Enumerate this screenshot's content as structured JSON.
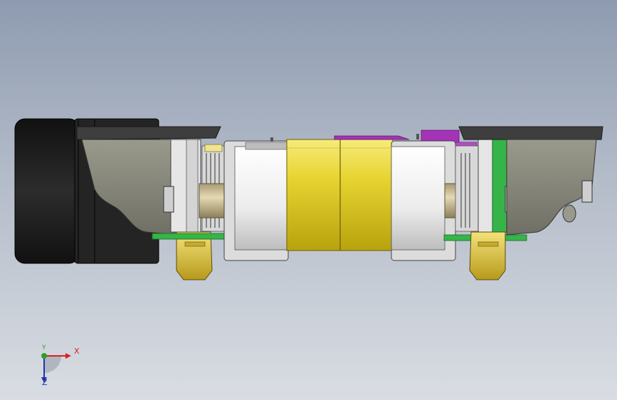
{
  "viewport": {
    "background_top": "#8e9bb0",
    "background_bottom": "#d9dde3"
  },
  "model": {
    "colors": {
      "tire": "#1e1e1e",
      "housing_gray": "#8b8b7e",
      "dark_plate": "#3e3e3e",
      "white_part": "#f2f2f2",
      "yellow_motor": "#e7d431",
      "shaft_tan": "#c9b98c",
      "magenta_part": "#a533b8",
      "green_board": "#36b449",
      "brass_bracket": "#e5c94a"
    }
  },
  "triad": {
    "x_label": "X",
    "y_label": "Y",
    "z_label": "Z",
    "x_color": "#d82020",
    "y_color": "#2aa12a",
    "z_color": "#2233aa"
  }
}
